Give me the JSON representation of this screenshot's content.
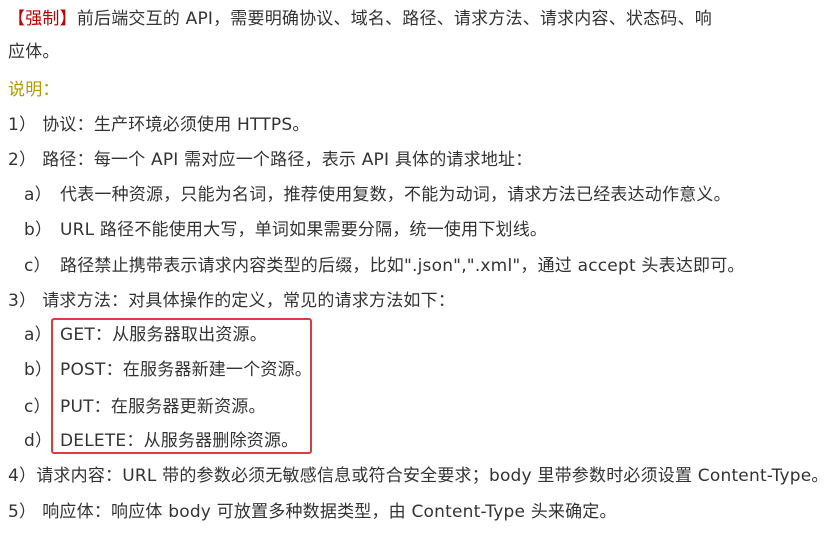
{
  "rule": {
    "tag": "【强制】",
    "line1": "前后端交互的 API，需要明确协议、域名、路径、请求方法、请求内容、状态码、响",
    "line2": "应体。"
  },
  "note_label": "说明：",
  "items": {
    "protocol": {
      "marker": "1）",
      "text": "协议：生产环境必须使用 HTTPS。"
    },
    "path": {
      "marker": "2）",
      "text": "路径：每一个 API 需对应一个路径，表示 API 具体的请求地址：",
      "sub": [
        {
          "marker": "a）",
          "text": "代表一种资源，只能为名词，推荐使用复数，不能为动词，请求方法已经表达动作意义。"
        },
        {
          "marker": "b）",
          "text": "URL 路径不能使用大写，单词如果需要分隔，统一使用下划线。"
        },
        {
          "marker": "c）",
          "text": "路径禁止携带表示请求内容类型的后缀，比如\".json\",\".xml\"，通过 accept 头表达即可。"
        }
      ]
    },
    "method": {
      "marker": "3）",
      "text": "请求方法：对具体操作的定义，常见的请求方法如下：",
      "sub": [
        {
          "marker": "a）",
          "text": "GET：从服务器取出资源。"
        },
        {
          "marker": "b）",
          "text": "POST：在服务器新建一个资源。"
        },
        {
          "marker": "c）",
          "text": "PUT：在服务器更新资源。"
        },
        {
          "marker": "d）",
          "text": "DELETE：从服务器删除资源。"
        }
      ]
    },
    "content": {
      "marker": "4）",
      "text": "请求内容：URL 带的参数必须无敏感信息或符合安全要求；body 里带参数时必须设置 Content-Type。"
    },
    "response": {
      "marker": "5）",
      "text": "响应体：响应体 body 可放置多种数据类型，由 Content-Type 头来确定。"
    }
  },
  "colors": {
    "tag": "#c00000",
    "note": "#b59800",
    "text": "#333333",
    "highlight_border": "#e0393e"
  }
}
